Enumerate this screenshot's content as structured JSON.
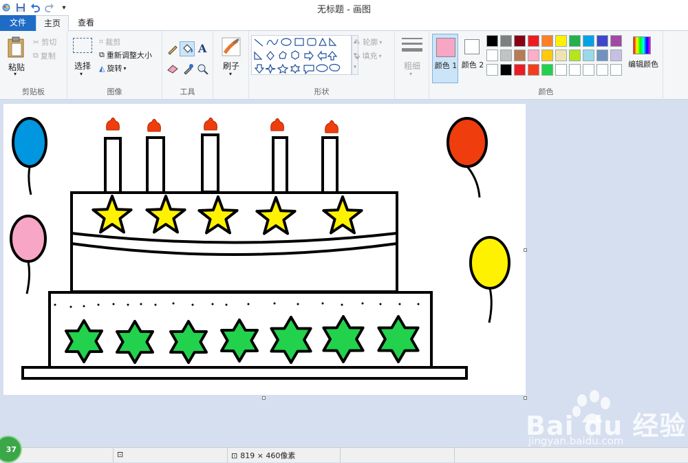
{
  "window": {
    "title": "无标题 - 画图"
  },
  "tabs": {
    "file": "文件",
    "home": "主页",
    "view": "查看"
  },
  "clipboard": {
    "label": "剪贴板",
    "paste": "粘贴",
    "cut": "剪切",
    "copy": "复制"
  },
  "image": {
    "label": "图像",
    "select": "选择",
    "crop": "裁剪",
    "resize": "重新调整大小",
    "rotate": "旋转"
  },
  "tools": {
    "label": "工具"
  },
  "brushes": {
    "label": "刷子"
  },
  "shapes": {
    "label": "形状",
    "outline": "轮廓",
    "fill": "填充"
  },
  "size": {
    "label": "粗细"
  },
  "colors": {
    "label": "颜色",
    "color1": "颜色 1",
    "color2": "颜色 2",
    "edit": "编辑颜色",
    "color1_value": "#f7a6c6",
    "color2_value": "#ffffff",
    "palette_row1": [
      "#000000",
      "#7f7f7f",
      "#880015",
      "#ed1c24",
      "#ff7f27",
      "#fff200",
      "#22b14c",
      "#00a2e8",
      "#3f48cc",
      "#a349a4"
    ],
    "palette_row2": [
      "#ffffff",
      "#c3c3c3",
      "#b97a57",
      "#ffaec9",
      "#ffc90e",
      "#efe4b0",
      "#b5e61d",
      "#99d9ea",
      "#7092be",
      "#c8bfe7"
    ],
    "palette_row3": [
      "#ffffff",
      "#000000",
      "#ed1c24",
      "#f53d1b",
      "#22d14c",
      "#ffffff",
      "#ffffff",
      "#ffffff",
      "#ffffff",
      "#ffffff"
    ]
  },
  "drawing": {
    "balloon_colors": [
      "#0096e0",
      "#f7a6c6",
      "#ef3d0e",
      "#fff200"
    ],
    "star_yellow": "#fff200",
    "star_green": "#22d14c",
    "flame": "#ef3d0e"
  },
  "status": {
    "size_text": "819 × 460像素",
    "badge": "37"
  }
}
